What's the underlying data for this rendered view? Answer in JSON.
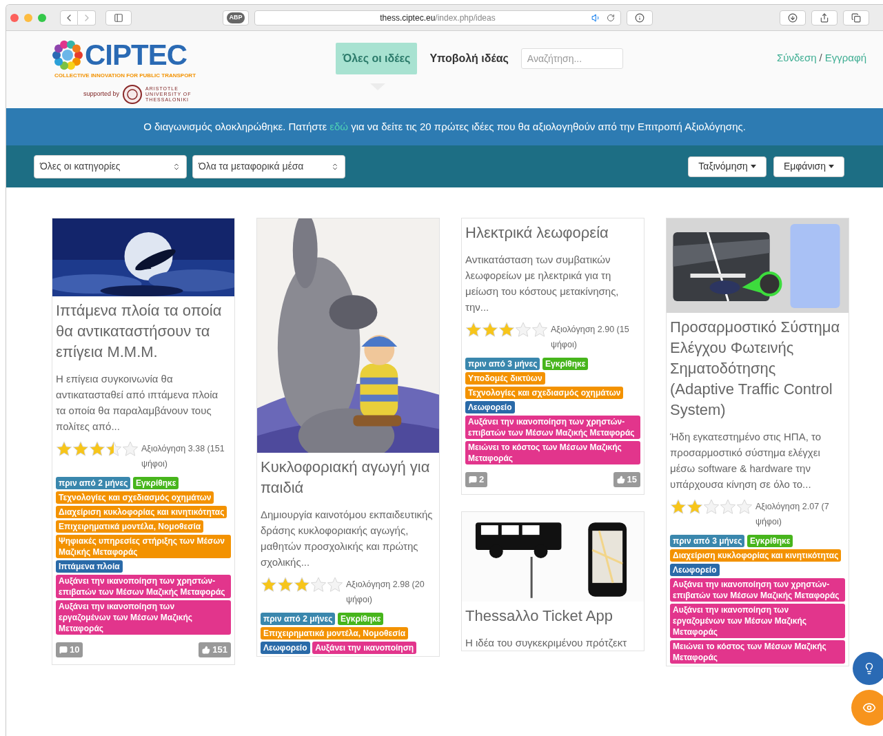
{
  "browser": {
    "adblock_label": "ABP",
    "url_domain": "thess.ciptec.eu",
    "url_path": "/index.php/ideas"
  },
  "header": {
    "logo": {
      "name": "CIPTEC",
      "tagline": "COLLECTIVE INNOVATION FOR PUBLIC TRANSPORT",
      "supported_by": "supported by",
      "university": [
        "ARISTOTLE",
        "UNIVERSITY OF",
        "THESSALONIKI"
      ]
    },
    "nav": [
      {
        "label": "Όλες οι ιδέες",
        "selected": true
      },
      {
        "label": "Υποβολή ιδέας",
        "selected": false
      }
    ],
    "search": {
      "placeholder": "Αναζήτηση..."
    },
    "auth": {
      "login": "Σύνδεση",
      "separator": "/",
      "register": "Εγγραφή"
    }
  },
  "banner": {
    "before": "Ο διαγωνισμός ολοκληρώθηκε. Πατήστε ",
    "link": "εδώ",
    "after": " για να δείτε τις 20 πρώτες ιδέες που θα αξιολογηθούν από την Επιτροπή Αξιολόγησης."
  },
  "filters": {
    "selects": [
      "Όλες οι κατηγορίες",
      "Όλα τα μεταφορικά μέσα"
    ],
    "buttons": [
      "Ταξινόμηση",
      "Εμφάνιση"
    ]
  },
  "columns": [
    [
      {
        "title": "Ιπτάμενα πλοία τα οποία θα αντικαταστήσουν τα επίγεια Μ.Μ.Μ.",
        "description": "Η επίγεια συγκοινωνία θα αντικατασταθεί από ιπτάμενα πλοία τα οποία θα παραλαμβάνουν τους πολίτες από...",
        "stars": 3.5,
        "rating": "Αξιολόγηση 3.38 (151 ψήφοι)",
        "tags": [
          {
            "kind": "time",
            "label": "πριν από 2 μήνες"
          },
          {
            "kind": "status",
            "label": "Εγκρίθηκε"
          },
          {
            "kind": "category",
            "label": "Τεχνολογίες και σχεδιασμός οχημάτων"
          },
          {
            "kind": "category",
            "label": "Διαχείριση κυκλοφορίας και κινητικότητας"
          },
          {
            "kind": "category",
            "label": "Επιχειρηματικά μοντέλα, Νομοθεσία"
          },
          {
            "kind": "category",
            "label": "Ψηφιακές υπηρεσίες στήριξης των Μέσων Μαζικής Μεταφοράς"
          },
          {
            "kind": "vehicle",
            "label": "Ιπτάμενα πλοία"
          },
          {
            "kind": "benefit",
            "label": "Αυξάνει την ικανοποίηση των χρηστών-επιβατών των Μέσων Μαζικής Μεταφοράς"
          },
          {
            "kind": "benefit",
            "label": "Αυξάνει την ικανοποίηση των εργαζομένων των Μέσων Μαζικής Μεταφοράς"
          }
        ],
        "comments": "10",
        "likes": "151"
      }
    ],
    [
      {
        "title": "Κυκλοφοριακή αγωγή για παιδιά",
        "description": "Δημιουργία καινοτόμου εκπαιδευτικής δράσης κυκλοφοριακής αγωγής, μαθητών προσχολικής και πρώτης σχολικής...",
        "stars": 3,
        "rating": "Αξιολόγηση 2.98 (20 ψήφοι)",
        "tags": [
          {
            "kind": "time",
            "label": "πριν από 2 μήνες"
          },
          {
            "kind": "status",
            "label": "Εγκρίθηκε"
          },
          {
            "kind": "category",
            "label": "Επιχειρηματικά μοντέλα, Νομοθεσία"
          },
          {
            "kind": "vehicle",
            "label": "Λεωφορείο"
          },
          {
            "kind": "benefit",
            "label": "Αυξάνει την ικανοποίηση"
          }
        ]
      }
    ],
    [
      {
        "title": "Ηλεκτρικά λεωφορεία",
        "description": "Αντικατάσταση των συμβατικών λεωφορείων με ηλεκτρικά για τη μείωση του κόστους μετακίνησης, την...",
        "stars": 3,
        "rating": "Αξιολόγηση 2.90 (15 ψήφοι)",
        "tags": [
          {
            "kind": "time",
            "label": "πριν από 3 μήνες"
          },
          {
            "kind": "status",
            "label": "Εγκρίθηκε"
          },
          {
            "kind": "category",
            "label": "Υποδομές δικτύων"
          },
          {
            "kind": "category",
            "label": "Τεχνολογίες και σχεδιασμός οχημάτων"
          },
          {
            "kind": "vehicle",
            "label": "Λεωφορείο"
          },
          {
            "kind": "benefit",
            "label": "Αυξάνει την ικανοποίηση των χρηστών-επιβατών των Μέσων Μαζικής Μεταφοράς"
          },
          {
            "kind": "benefit",
            "label": "Μειώνει το κόστος των Μέσων Μαζικής Μεταφοράς"
          }
        ],
        "comments": "2",
        "likes": "15"
      },
      {
        "title": "Thessaλλo Ticket App",
        "description": "Η ιδέα του συγκεκριμένου πρότζεκτ"
      }
    ],
    [
      {
        "title": "Προσαρμοστικό Σύστημα Ελέγχου Φωτεινής Σηματοδότησης (Adaptive Traffic Control System)",
        "description": "Ήδη εγκατεστημένο στις ΗΠΑ, το προσαρμοστικό σύστημα ελέγχει μέσω software & hardware την υπάρχουσα κίνηση σε όλο το...",
        "stars": 2,
        "rating": "Αξιολόγηση 2.07 (7 ψήφοι)",
        "tags": [
          {
            "kind": "time",
            "label": "πριν από 3 μήνες"
          },
          {
            "kind": "status",
            "label": "Εγκρίθηκε"
          },
          {
            "kind": "category",
            "label": "Διαχείριση κυκλοφορίας και κινητικότητας"
          },
          {
            "kind": "vehicle",
            "label": "Λεωφορείο"
          },
          {
            "kind": "benefit",
            "label": "Αυξάνει την ικανοποίηση των χρηστών-επιβατών των Μέσων Μαζικής Μεταφοράς"
          },
          {
            "kind": "benefit",
            "label": "Αυξάνει την ικανοποίηση των εργαζομένων των Μέσων Μαζικής Μεταφοράς"
          },
          {
            "kind": "benefit",
            "label": "Μειώνει το κόστος των Μέσων Μαζικής Μεταφοράς"
          }
        ]
      }
    ]
  ]
}
